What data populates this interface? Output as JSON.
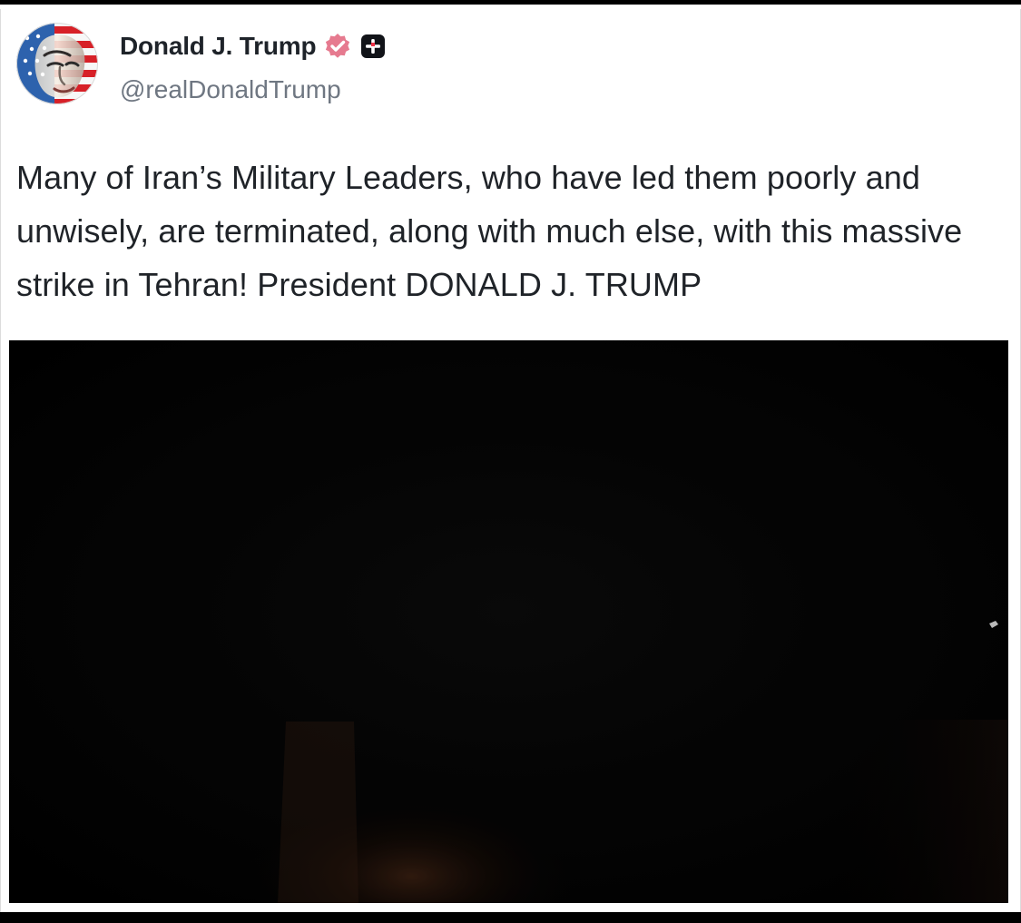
{
  "post": {
    "display_name": "Donald J. Trump",
    "handle": "@realDonaldTrump",
    "text": "Many of Iran’s Military Leaders, who have led them poorly and unwisely, are terminated, along with much else, with this massive strike in Tehran! President DONALD J. TRUMP"
  },
  "icons": {
    "verified_badge": "verified-badge-icon",
    "plus_badge": "plus-badge-icon"
  },
  "colors": {
    "name": "#1e2329",
    "handle": "#6f7782",
    "text": "#1f2328",
    "verified": "#e67a8f",
    "plus_badge": "#111318",
    "video_background": "#050505"
  }
}
